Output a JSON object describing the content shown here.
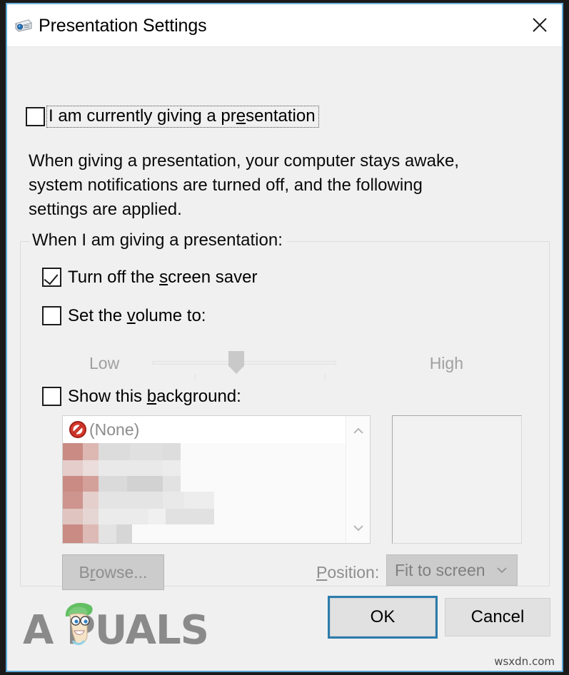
{
  "window": {
    "title": "Presentation Settings",
    "icon": "projector-icon",
    "close_label": "✕",
    "border_color": "#5aa8d8"
  },
  "presenting": {
    "label_pre": "I am currently giving a pr",
    "label_key": "e",
    "label_post": "sentation",
    "checked": false
  },
  "description": "When giving a presentation, your computer stays awake, system notifications are turned off, and the following settings are applied.",
  "group": {
    "legend": "When I am giving a presentation:",
    "screensaver": {
      "pre": "Turn off the ",
      "key": "s",
      "post": "creen saver",
      "checked": true
    },
    "volume": {
      "pre": "Set the ",
      "key": "v",
      "post": "olume to:",
      "checked": false,
      "enabled": false
    },
    "background": {
      "pre": "Show this ",
      "key": "b",
      "post": "ackground:",
      "checked": false,
      "enabled": false
    }
  },
  "slider": {
    "low_label": "Low",
    "high_label": "High",
    "value_percent": 50,
    "enabled": false
  },
  "listbox": {
    "items": [
      {
        "label": "(None)",
        "icon": "no-entry-icon"
      }
    ],
    "scrollbar": {
      "up": "∧",
      "down": "∨"
    }
  },
  "preview": {
    "empty": true
  },
  "browse": {
    "pre": "B",
    "key": "r",
    "post": "owse...",
    "enabled": false
  },
  "position": {
    "label_pre": "",
    "label_key": "P",
    "label_post": "osition:",
    "value": "Fit to screen",
    "chevron": "∨",
    "enabled": false
  },
  "buttons": {
    "ok": "OK",
    "cancel": "Cancel",
    "default_button": "ok",
    "focus_color": "#2b7cac"
  },
  "watermark": {
    "brand": "A      PUALS",
    "site": "wsxdn.com"
  }
}
